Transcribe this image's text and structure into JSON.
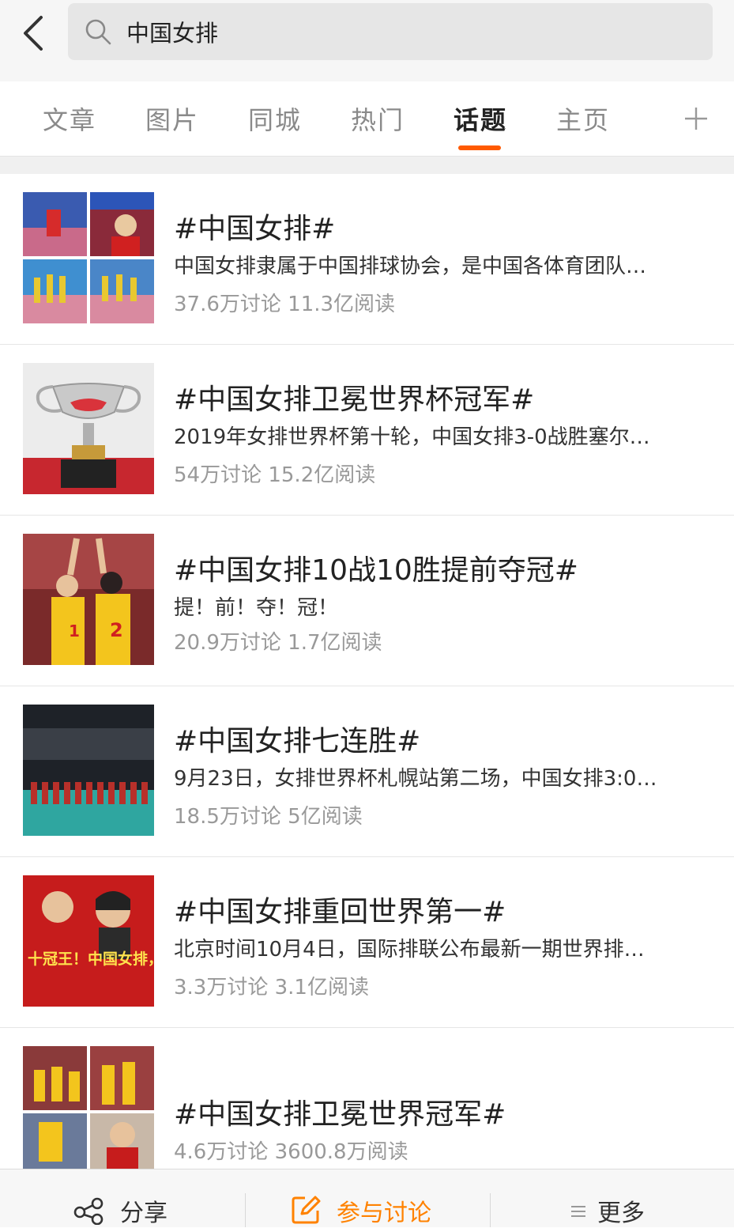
{
  "search": {
    "query": "中国女排"
  },
  "tabs": [
    {
      "label": "文章"
    },
    {
      "label": "图片"
    },
    {
      "label": "同城"
    },
    {
      "label": "热门"
    },
    {
      "label": "话题"
    },
    {
      "label": "主页"
    }
  ],
  "active_tab": "话题",
  "colors": {
    "accent": "#ff5a00",
    "meta_text": "#999999",
    "tab_inactive": "#8a8a8a"
  },
  "topics": [
    {
      "title": "#中国女排#",
      "desc": "中国女排隶属于中国排球协会，是中国各体育团队…",
      "meta": "37.6万讨论 11.3亿阅读"
    },
    {
      "title": "#中国女排卫冕世界杯冠军#",
      "desc": "2019年女排世界杯第十轮，中国女排3-0战胜塞尔…",
      "meta": "54万讨论 15.2亿阅读"
    },
    {
      "title": "#中国女排10战10胜提前夺冠#",
      "desc": "提！前！夺！冠！",
      "meta": "20.9万讨论 1.7亿阅读"
    },
    {
      "title": "#中国女排七连胜#",
      "desc": "9月23日，女排世界杯札幌站第二场，中国女排3:0…",
      "meta": "18.5万讨论 5亿阅读"
    },
    {
      "title": "#中国女排重回世界第一#",
      "desc": "北京时间10月4日，国际排联公布最新一期世界排…",
      "meta": "3.3万讨论 3.1亿阅读"
    },
    {
      "title": "#中国女排卫冕世界冠军#",
      "meta": "4.6万讨论 3600.8万阅读"
    }
  ],
  "thumb_text": {
    "poster": "十冠王！中国女排，牛！"
  },
  "bottom": {
    "share": "分享",
    "discuss": "参与讨论",
    "more": "更多"
  }
}
